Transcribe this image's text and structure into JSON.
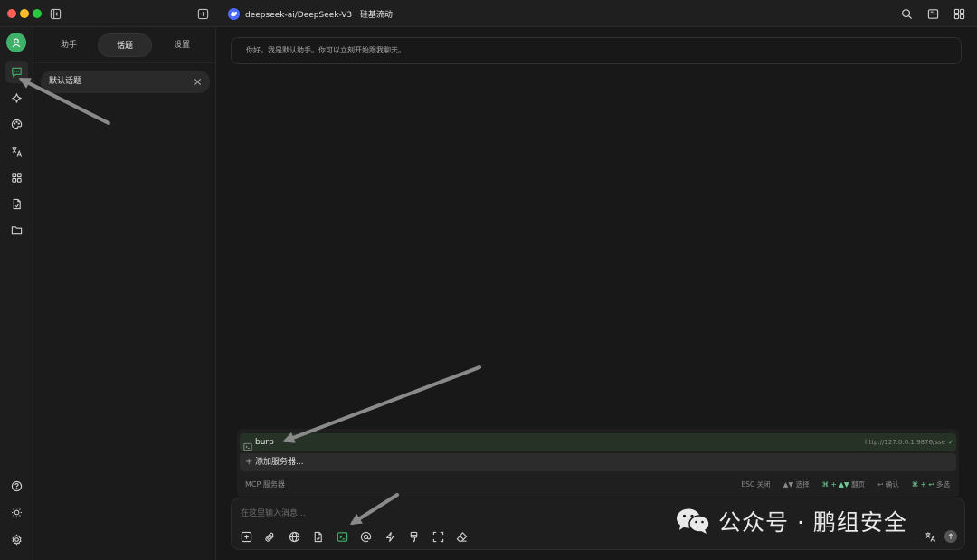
{
  "window": {
    "title": "deepseek-ai/DeepSeek-V3 | 硅基流动"
  },
  "sidebar": {
    "tabs": [
      {
        "label": "助手"
      },
      {
        "label": "话题"
      },
      {
        "label": "设置"
      }
    ],
    "topics": [
      {
        "label": "默认话题"
      }
    ]
  },
  "chat": {
    "greeting": "你好，我是默认助手。你可以立刻开始跟我聊天。"
  },
  "mcp": {
    "servers": [
      {
        "name": "burp",
        "url": "http://127.0.0.1:9876/sse",
        "status": "✓"
      }
    ],
    "add_label": "添加服务器...",
    "footer_label": "MCP 服务器",
    "hints": [
      {
        "key": "ESC",
        "text": "关闭"
      },
      {
        "key": "▲▼",
        "text": "选择"
      },
      {
        "key": "⌘ + ▲▼",
        "text": "翻页"
      },
      {
        "key": "↩",
        "text": "确认"
      },
      {
        "key": "⌘ + ↩",
        "text": "多选"
      }
    ]
  },
  "input": {
    "placeholder": "在这里输入消息..."
  },
  "watermark": {
    "text": "公众号 · 鹏组安全"
  },
  "colors": {
    "accent": "#3fb26a",
    "background": "#181818",
    "sidebar": "#1b1b1b"
  }
}
